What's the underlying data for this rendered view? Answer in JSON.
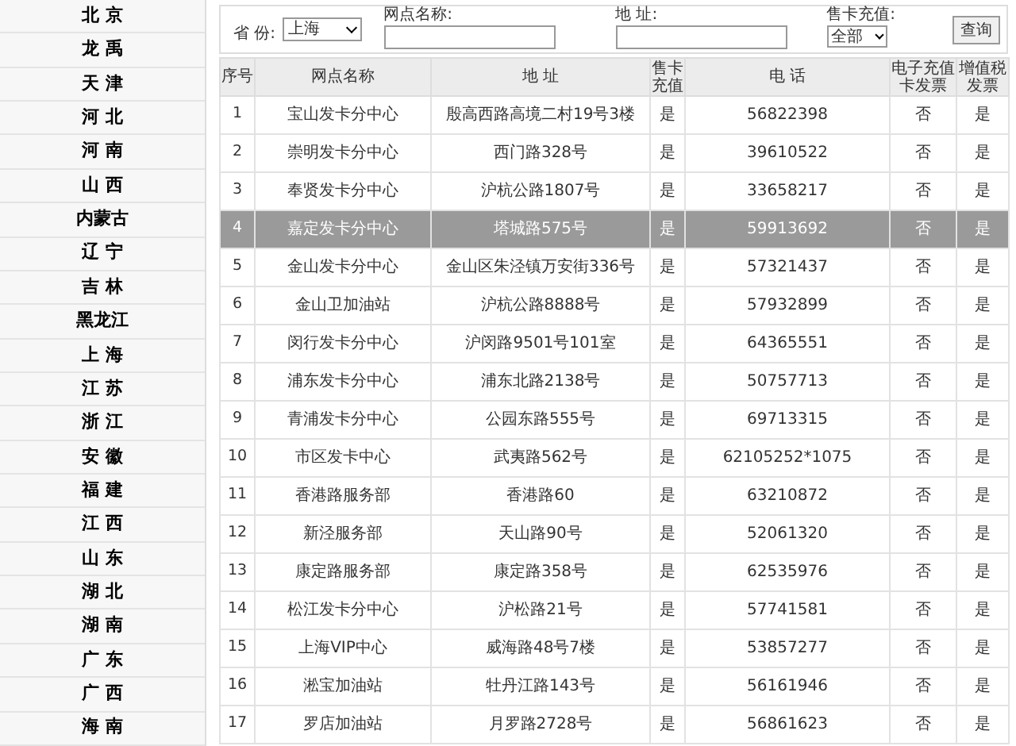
{
  "sidebar": {
    "items": [
      "北 京",
      "龙 禹",
      "天 津",
      "河 北",
      "河 南",
      "山 西",
      "内蒙古",
      "辽 宁",
      "吉 林",
      "黑龙江",
      "上 海",
      "江 苏",
      "浙 江",
      "安 徽",
      "福 建",
      "江 西",
      "山 东",
      "湖 北",
      "湖 南",
      "广 东",
      "广 西",
      "海 南"
    ]
  },
  "filters": {
    "province": {
      "label": "省 份:",
      "value": "上海"
    },
    "outlet_name": {
      "label": "网点名称:"
    },
    "address": {
      "label": "地 址:"
    },
    "card_recharge": {
      "label": "售卡充值:",
      "value": "全部"
    },
    "search_button": "查询"
  },
  "table": {
    "columns": [
      "序号",
      "网点名称",
      "地 址",
      "售卡充值",
      "电 话",
      "电子充值卡发票",
      "增值税发票"
    ],
    "rows": [
      {
        "cells": [
          "1",
          "宝山发卡分中心",
          "殷高西路高境二村19号3楼",
          "是",
          "56822398",
          "否",
          "是"
        ],
        "selected": false
      },
      {
        "cells": [
          "2",
          "崇明发卡分中心",
          "西门路328号",
          "是",
          "39610522",
          "否",
          "是"
        ],
        "selected": false
      },
      {
        "cells": [
          "3",
          "奉贤发卡分中心",
          "沪杭公路1807号",
          "是",
          "33658217",
          "否",
          "是"
        ],
        "selected": false
      },
      {
        "cells": [
          "4",
          "嘉定发卡分中心",
          "塔城路575号",
          "是",
          "59913692",
          "否",
          "是"
        ],
        "selected": true
      },
      {
        "cells": [
          "5",
          "金山发卡分中心",
          "金山区朱泾镇万安街336号",
          "是",
          "57321437",
          "否",
          "是"
        ],
        "selected": false
      },
      {
        "cells": [
          "6",
          "金山卫加油站",
          "沪杭公路8888号",
          "是",
          "57932899",
          "否",
          "是"
        ],
        "selected": false
      },
      {
        "cells": [
          "7",
          "闵行发卡分中心",
          "沪闵路9501号101室",
          "是",
          "64365551",
          "否",
          "是"
        ],
        "selected": false
      },
      {
        "cells": [
          "8",
          "浦东发卡分中心",
          "浦东北路2138号",
          "是",
          "50757713",
          "否",
          "是"
        ],
        "selected": false
      },
      {
        "cells": [
          "9",
          "青浦发卡分中心",
          "公园东路555号",
          "是",
          "69713315",
          "否",
          "是"
        ],
        "selected": false
      },
      {
        "cells": [
          "10",
          "市区发卡中心",
          "武夷路562号",
          "是",
          "62105252*1075",
          "否",
          "是"
        ],
        "selected": false
      },
      {
        "cells": [
          "11",
          "香港路服务部",
          "香港路60",
          "是",
          "63210872",
          "否",
          "是"
        ],
        "selected": false
      },
      {
        "cells": [
          "12",
          "新泾服务部",
          "天山路90号",
          "是",
          "52061320",
          "否",
          "是"
        ],
        "selected": false
      },
      {
        "cells": [
          "13",
          "康定路服务部",
          "康定路358号",
          "是",
          "62535976",
          "否",
          "是"
        ],
        "selected": false
      },
      {
        "cells": [
          "14",
          "松江发卡分中心",
          "沪松路21号",
          "是",
          "57741581",
          "否",
          "是"
        ],
        "selected": false
      },
      {
        "cells": [
          "15",
          "上海VIP中心",
          "威海路48号7楼",
          "是",
          "53857277",
          "否",
          "是"
        ],
        "selected": false
      },
      {
        "cells": [
          "16",
          "淞宝加油站",
          "牡丹江路143号",
          "是",
          "56161946",
          "否",
          "是"
        ],
        "selected": false
      },
      {
        "cells": [
          "17",
          "罗店加油站",
          "月罗路2728号",
          "是",
          "56861623",
          "否",
          "是"
        ],
        "selected": false
      }
    ]
  }
}
